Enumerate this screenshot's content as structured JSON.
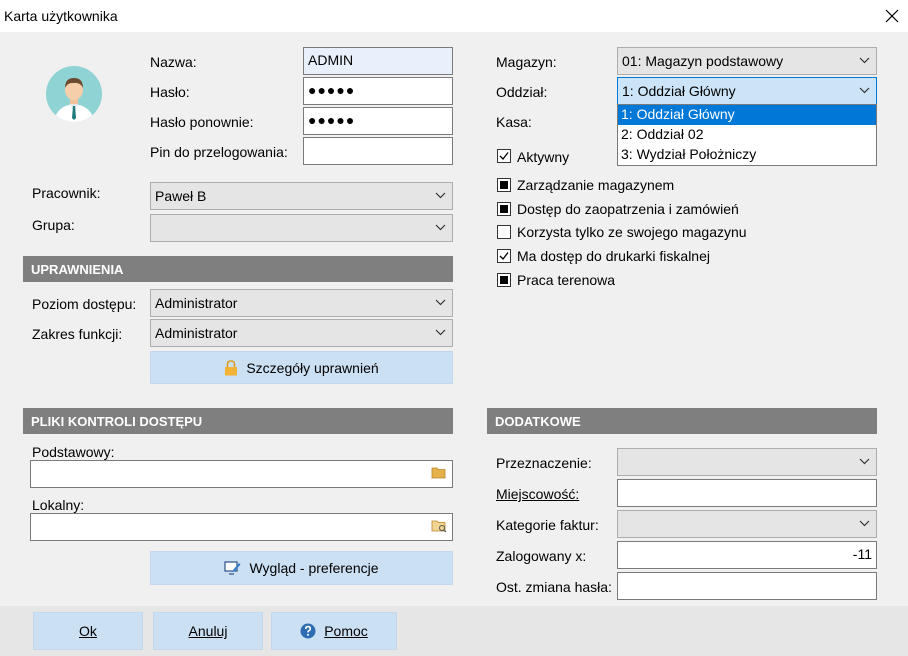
{
  "window": {
    "title": "Karta użytkownika"
  },
  "user": {
    "name_label": "Nazwa:",
    "name_value": "ADMIN",
    "password_label": "Hasło:",
    "password_value": "●●●●●",
    "password_repeat_label": "Hasło ponownie:",
    "password_repeat_value": "●●●●●",
    "pin_label": "Pin do przelogowania:",
    "pin_value": "",
    "employee_label": "Pracownik:",
    "employee_value": "Paweł B",
    "group_label": "Grupa:",
    "group_value": ""
  },
  "permissions": {
    "header": "UPRAWNIENIA",
    "level_label": "Poziom dostępu:",
    "level_value": "Administrator",
    "scope_label": "Zakres funkcji:",
    "scope_value": "Administrator",
    "details_button": "Szczegóły uprawnień"
  },
  "access_files": {
    "header": "PLIKI KONTROLI DOSTĘPU",
    "primary_label": "Podstawowy:",
    "primary_value": "",
    "local_label": "Lokalny:",
    "local_value": "",
    "appearance_button": "Wygląd - preferencje"
  },
  "right": {
    "warehouse_label": "Magazyn:",
    "warehouse_value": "01: Magazyn podstawowy",
    "branch_label": "Oddział:",
    "branch_value": "1: Oddział Główny",
    "branch_options": [
      "1: Oddział Główny",
      "2: Oddział 02",
      "3: Wydział Położniczy"
    ],
    "cash_label": "Kasa:",
    "checkboxes": [
      {
        "label": "Aktywny",
        "state": "checked"
      },
      {
        "label": "Zarządzanie magazynem",
        "state": "indeterminate"
      },
      {
        "label": "Dostęp do zaopatrzenia i zamówień",
        "state": "indeterminate"
      },
      {
        "label": "Korzysta tylko ze swojego magazynu",
        "state": "unchecked"
      },
      {
        "label": "Ma dostęp do drukarki fiskalnej",
        "state": "checked"
      },
      {
        "label": "Praca terenowa",
        "state": "indeterminate"
      }
    ]
  },
  "additional": {
    "header": "DODATKOWE",
    "purpose_label": "Przeznaczenie:",
    "purpose_value": "",
    "city_label": "Miejscowość:",
    "city_value": "",
    "invoice_cat_label": "Kategorie faktur:",
    "invoice_cat_value": "",
    "logged_label": "Zalogowany x:",
    "logged_value": "-11",
    "pwd_change_label": "Ost. zmiana hasła:",
    "pwd_change_value": ""
  },
  "footer": {
    "ok": "Ok",
    "cancel": "Anuluj",
    "help": "Pomoc"
  }
}
